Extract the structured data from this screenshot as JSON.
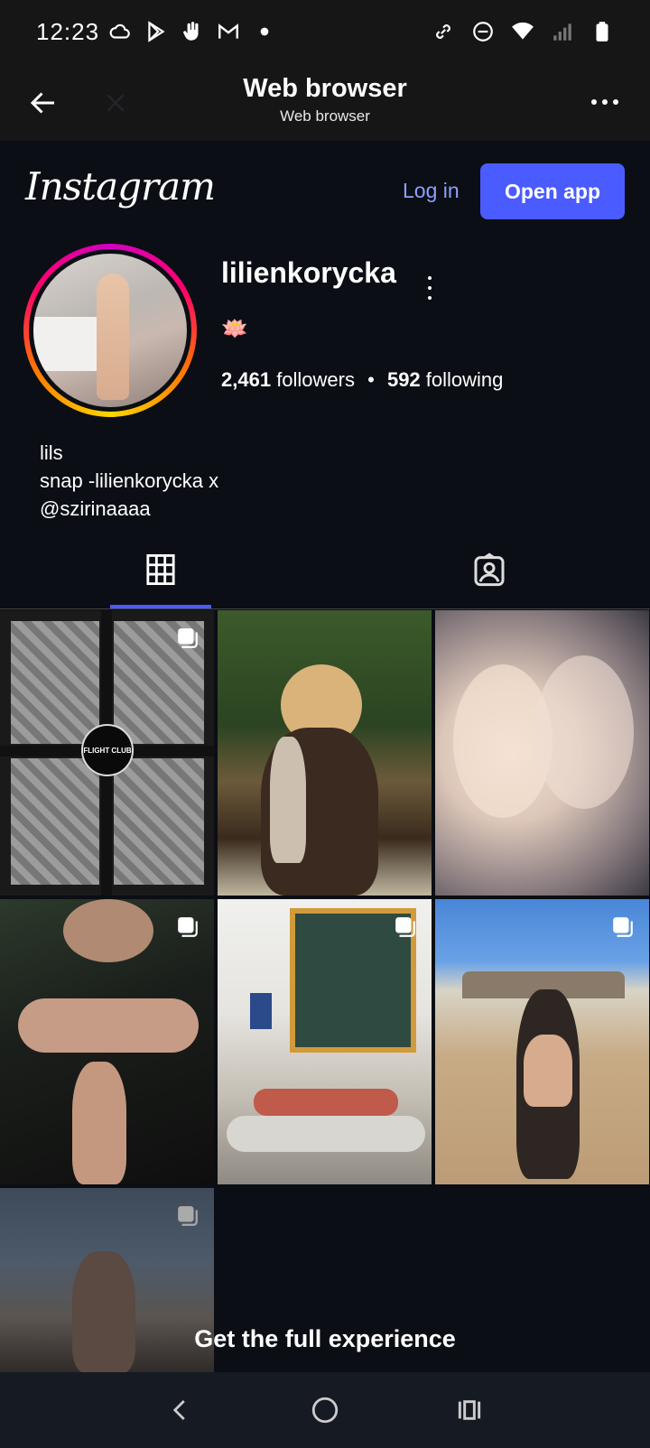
{
  "status_bar": {
    "time": "12:23",
    "left_icons": [
      "cloud-icon",
      "play-store-icon",
      "hand-icon",
      "gmail-icon",
      "dot-icon"
    ],
    "right_icons": [
      "link-icon",
      "dnd-icon",
      "wifi-icon",
      "signal-icon",
      "battery-icon"
    ]
  },
  "browser": {
    "title": "Web browser",
    "subtitle": "Web browser"
  },
  "instagram": {
    "logo": "Instagram",
    "login_label": "Log in",
    "open_app_label": "Open app",
    "brand_color": "#4a5cff"
  },
  "profile": {
    "username": "lilienkorycka",
    "emoji": "🪷",
    "followers_count": "2,461",
    "followers_label": "followers",
    "following_count": "592",
    "following_label": "following",
    "bio_lines": [
      "lils",
      "snap -lilienkorycka x",
      "@szirinaaaa"
    ]
  },
  "tabs": [
    {
      "name": "grid",
      "icon": "grid-icon",
      "active": true
    },
    {
      "name": "tagged",
      "icon": "tagged-icon",
      "active": false
    }
  ],
  "posts": [
    {
      "multi": true,
      "badge": "FLIGHT CLUB"
    },
    {
      "multi": false
    },
    {
      "multi": false
    },
    {
      "multi": true
    },
    {
      "multi": true
    },
    {
      "multi": true
    },
    {
      "multi": true
    }
  ],
  "banner": {
    "text": "Get the full experience"
  },
  "nav": [
    "back-icon",
    "home-icon",
    "recents-icon"
  ]
}
